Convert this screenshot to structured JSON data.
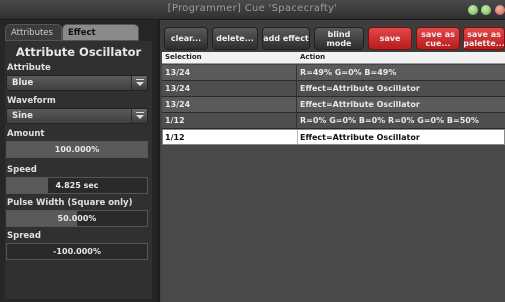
{
  "window": {
    "title": "[Programmer] Cue 'Spacecrafty'"
  },
  "left": {
    "tabs": [
      {
        "label": "Attributes",
        "active": false
      },
      {
        "label": "Effect Params",
        "active": true
      }
    ],
    "heading": "Attribute Oscillator",
    "attribute": {
      "label": "Attribute",
      "value": "Blue"
    },
    "waveform": {
      "label": "Waveform",
      "value": "Sine"
    },
    "amount": {
      "label": "Amount",
      "value": "100.000%",
      "level": 1.0
    },
    "speed": {
      "label": "Speed",
      "value": "4.825 sec",
      "level": 0.29
    },
    "pulse_width": {
      "label": "Pulse Width (Square only)",
      "value": "50.000%",
      "level": 0.5
    },
    "spread": {
      "label": "Spread",
      "value": "-100.000%",
      "level": 0.0
    }
  },
  "toolbar": {
    "clear": "clear...",
    "delete": "delete...",
    "add_effect": "add effect",
    "blind_mode": "blind mode",
    "save": "save",
    "save_as_cue": "save as cue...",
    "save_as_palette": "save as palette..."
  },
  "table": {
    "columns": [
      "Selection",
      "Action"
    ],
    "rows": [
      {
        "selection": "13/24",
        "action": "R=49% G=0% B=49%"
      },
      {
        "selection": "13/24",
        "action": "Effect=Attribute Oscillator"
      },
      {
        "selection": "13/24",
        "action": "Effect=Attribute Oscillator"
      },
      {
        "selection": "1/12",
        "action": "R=0% G=0% B=0% R=0% G=0% B=50%"
      },
      {
        "selection": "1/12",
        "action": "Effect=Attribute Oscillator",
        "selected": true
      }
    ]
  },
  "colors": {
    "accent_red": "#d42c2c",
    "panel_dark": "#303030",
    "selected_row": "#ffffff"
  }
}
